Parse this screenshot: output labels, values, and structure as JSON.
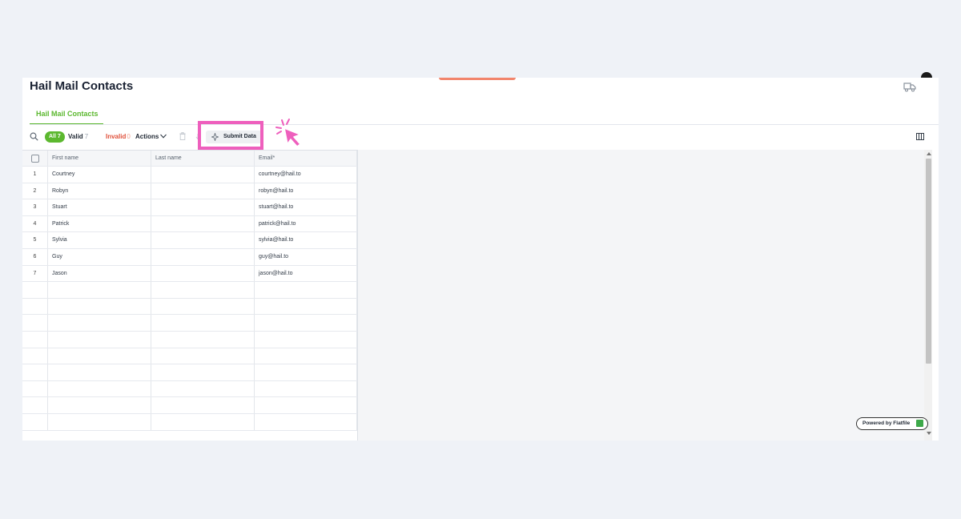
{
  "app": {
    "title": "Hail Mail Contacts"
  },
  "tabs": [
    {
      "label": "Hail Mail Contacts",
      "active": true
    }
  ],
  "toolbar": {
    "filters": {
      "all_label": "All",
      "all_count": "7",
      "valid_label": "Valid",
      "valid_count": "7",
      "invalid_label": "Invalid",
      "invalid_count": "0"
    },
    "actions_label": "Actions",
    "submit_label": "Submit Data"
  },
  "table": {
    "columns": [
      "First name",
      "Last name",
      "Email*"
    ],
    "rows": [
      {
        "index": "1",
        "first": "Courtney",
        "last": "",
        "email": "courtney@hail.to"
      },
      {
        "index": "2",
        "first": "Robyn",
        "last": "",
        "email": "robyn@hail.to"
      },
      {
        "index": "3",
        "first": "Stuart",
        "last": "",
        "email": "stuart@hail.to"
      },
      {
        "index": "4",
        "first": "Patrick",
        "last": "",
        "email": "patrick@hail.to"
      },
      {
        "index": "5",
        "first": "Sylvia",
        "last": "",
        "email": "sylvia@hail.to"
      },
      {
        "index": "6",
        "first": "Guy",
        "last": "",
        "email": "guy@hail.to"
      },
      {
        "index": "7",
        "first": "Jason",
        "last": "",
        "email": "jason@hail.to"
      }
    ]
  },
  "footer": {
    "powered_by": "Powered by Flatfile"
  },
  "colors": {
    "accent": "#5cb82f",
    "invalid": "#e0503a",
    "highlight": "#ee5fbd",
    "cursor": "#ee5fbd"
  },
  "icons": [
    "search-icon",
    "chevron-down-icon",
    "trash-icon",
    "download-icon",
    "sparkle-icon",
    "columns-icon",
    "truck-icon",
    "cursor-pointer-icon",
    "flatfile-logo-icon"
  ]
}
